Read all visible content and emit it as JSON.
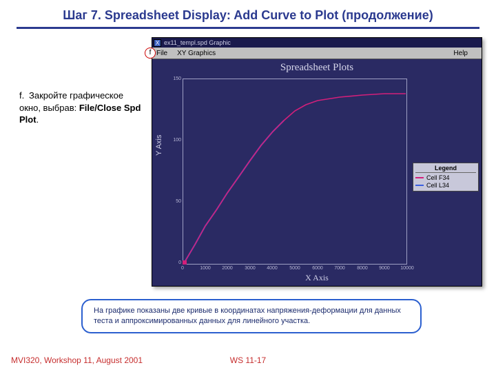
{
  "title": "Шаг 7.  Spreadsheet Display:  Add Curve to Plot (продолжение)",
  "instruction": {
    "letter": "f.",
    "text_a": "Закройте графическое окно, выбрав: ",
    "text_b": "File/Close Spd Plot",
    "text_c": "."
  },
  "marker": "f",
  "gwin": {
    "title": "ex11_templ.spd Graphic",
    "close_glyph": "X",
    "menu_file": "File",
    "menu_xy": "XY Graphics",
    "menu_help": "Help"
  },
  "plot": {
    "title": "Spreadsheet Plots",
    "xlabel": "X Axis",
    "ylabel": "Y Axis",
    "yticks": [
      "0",
      "50",
      "100",
      "150"
    ],
    "xticks": [
      "0",
      "1000",
      "2000",
      "3000",
      "4000",
      "5000",
      "6000",
      "7000",
      "8000",
      "9000",
      "10000"
    ],
    "legend_title": "Legend",
    "legend_items": [
      {
        "label": "Cell F34",
        "color": "#d31f7a"
      },
      {
        "label": "Cell L34",
        "color": "#3a5fe0"
      }
    ]
  },
  "caption": "На графике показаны две кривые в координатах напряжения-деформации для данных теста и аппроксимированных данных для линейного участка.",
  "footer_left": "MVI320, Workshop 11, August 2001",
  "footer_center": "WS 11-17",
  "chart_data": {
    "type": "line",
    "title": "Spreadsheet Plots",
    "xlabel": "X Axis",
    "ylabel": "Y Axis",
    "xlim": [
      0,
      10000
    ],
    "ylim": [
      0,
      150
    ],
    "series": [
      {
        "name": "Cell F34",
        "color": "#d31f7a",
        "x": [
          0,
          500,
          1000,
          1500,
          2000,
          2500,
          3000,
          3500,
          4000,
          4500,
          5000,
          5500,
          6000,
          7000,
          8000,
          9000,
          10000
        ],
        "y": [
          0,
          15,
          30,
          44,
          58,
          71,
          84,
          96,
          107,
          116,
          124,
          129,
          132,
          135,
          137,
          138,
          138
        ]
      },
      {
        "name": "Cell L34",
        "color": "#3a5fe0",
        "x": [
          0,
          500,
          1000,
          1500,
          2000,
          2500,
          3000,
          3500,
          4000,
          4500
        ],
        "y": [
          0,
          15,
          30,
          44,
          58,
          71,
          84,
          96,
          107,
          116
        ]
      }
    ]
  }
}
